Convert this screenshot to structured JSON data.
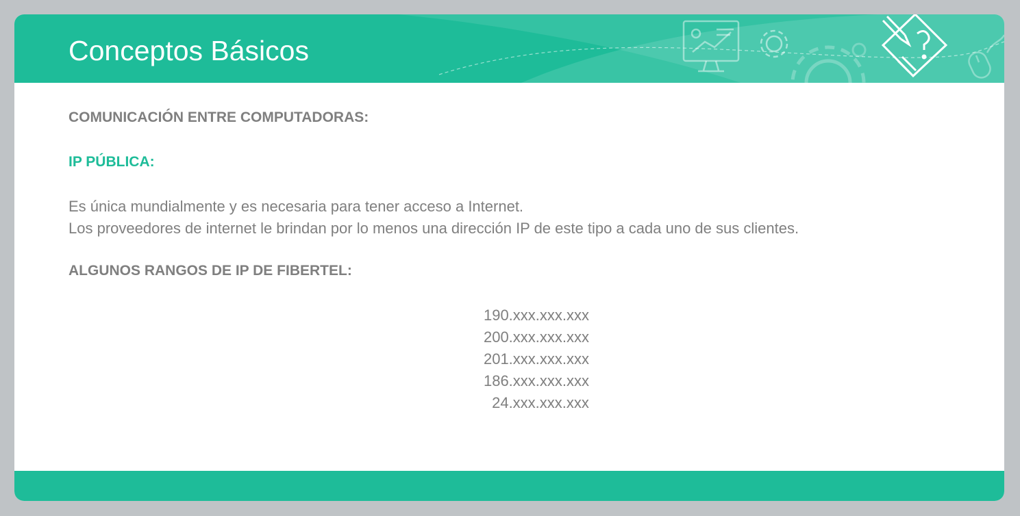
{
  "slide": {
    "title": "Conceptos Básicos",
    "heading_communication": "COMUNICACIÓN ENTRE COMPUTADORAS:",
    "heading_public_ip": "IP PÚBLICA:",
    "paragraph_1": "Es única mundialmente y es necesaria para tener acceso a Internet.",
    "paragraph_2": "Los proveedores de internet le brindan por lo menos una dirección IP de este tipo a cada uno de sus clientes.",
    "heading_ranges": "ALGUNOS RANGOS DE IP DE FIBERTEL:",
    "ip_ranges": [
      "190.xxx.xxx.xxx",
      "200.xxx.xxx.xxx",
      "201.xxx.xxx.xxx",
      "186.xxx.xxx.xxx",
      "24.xxx.xxx.xxx"
    ]
  },
  "icons": {
    "header": [
      "monitor-chart-icon",
      "gear-icon",
      "large-gear-icon",
      "pencil-question-icon",
      "mouse-icon"
    ]
  },
  "colors": {
    "accent": "#1ebc99",
    "text": "#7f7f7f",
    "background": "#bfc3c6",
    "slide": "#ffffff"
  }
}
